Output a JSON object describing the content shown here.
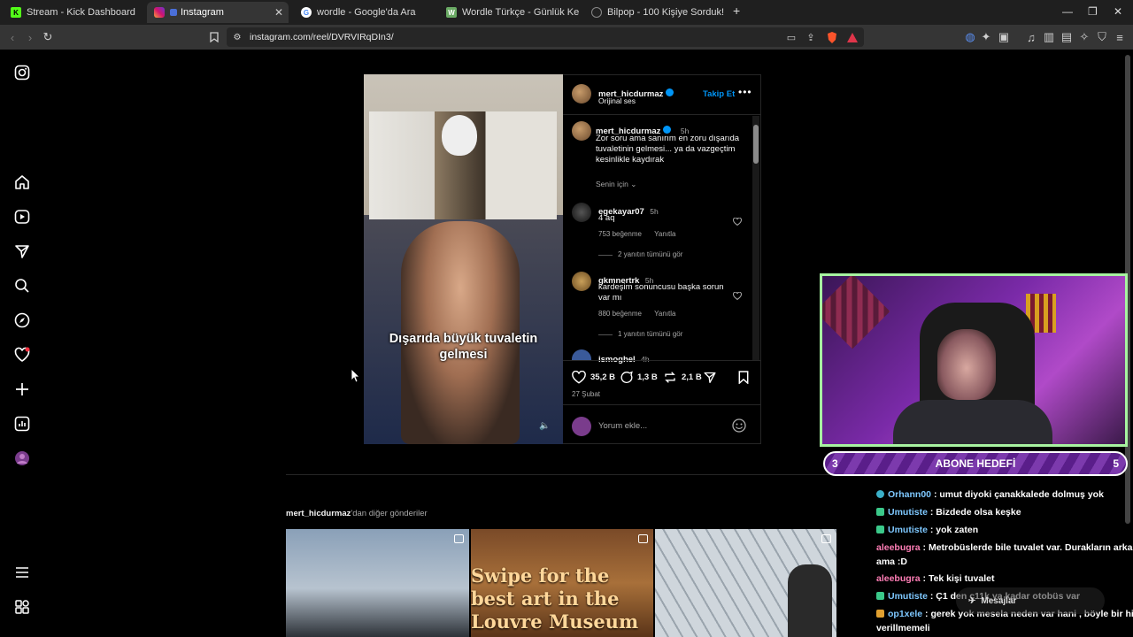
{
  "browser": {
    "tabs": [
      {
        "title": "Stream - Kick Dashboard",
        "favicon": "K",
        "color": "#53fc18"
      },
      {
        "title": "Instagram",
        "active": true
      },
      {
        "title": "wordle - Google'da Ara"
      },
      {
        "title": "Wordle Türkçe - Günlük Kelime Oyunu",
        "favicon": "W",
        "color": "#6aaa64"
      },
      {
        "title": "Bilpop - 100 Kişiye Sorduk!"
      }
    ],
    "url": "instagram.com/reel/DVRVIRqDIn3/"
  },
  "reel": {
    "caption_overlay": "Dışarıda büyük tuvaletin gelmesi",
    "author": "mert_hicdurmaz",
    "audio": "Orijinal ses",
    "follow_label": "Takip Et",
    "post": {
      "username": "mert_hicdurmaz",
      "time": "5h",
      "text": "Zor soru ama sanırım en zoru dışarıda tuvaletinin gelmesi... ya da vazgeçtim kesinlikle kaydırak"
    },
    "sort_label": "Senin için",
    "comments": [
      {
        "username": "egekayar07",
        "time": "5h",
        "text": "4 aq",
        "likes": "753 beğenme",
        "reply": "Yanıtla",
        "view_replies": "2 yanıtın tümünü gör"
      },
      {
        "username": "gkmnertrk",
        "time": "5h",
        "text": "kardeşim sonuncusu başka sorun var mı",
        "likes": "880 beğenme",
        "reply": "Yanıtla",
        "view_replies": "1 yanıtın tümünü gör"
      },
      {
        "username": "ismoghel",
        "time": "4h"
      }
    ],
    "likes": "35,2 B",
    "comments_count": "1,3 B",
    "reposts": "2,1 B",
    "date": "27 Şubat",
    "comment_placeholder": "Yorum ekle..."
  },
  "more_posts": {
    "user": "mert_hicdurmaz",
    "suffix": "'dan diğer gönderiler",
    "thumb2_text": "Swipe for the best art in the Louvre Museum"
  },
  "goal": {
    "left": "3",
    "label": "ABONE HEDEFİ",
    "right": "5"
  },
  "chat": [
    {
      "user": "Orhann00",
      "user_color": "#7ec8ff",
      "badge_color": "#3bb0c9",
      "text": ": umut diyoki çanakkalede dolmuş yok"
    },
    {
      "user": "Umutiste",
      "user_color": "#7ec8ff",
      "badge_color": "#3bc98a",
      "text": ": Bizdede olsa keşke"
    },
    {
      "user": "Umutiste",
      "user_color": "#7ec8ff",
      "badge_color": "#3bc98a",
      "text": ": yok zaten"
    },
    {
      "user": "aleebugra",
      "user_color": "#ff7eb6",
      "badge_color": "",
      "text": ": Metrobüslerde bile tuvalet var. Durakların arkası"
    },
    {
      "user": "",
      "user_color": "",
      "badge_color": "",
      "text": "ama :D"
    },
    {
      "user": "aleebugra",
      "user_color": "#ff7eb6",
      "badge_color": "",
      "text": ": Tek kişi tuvalet"
    },
    {
      "user": "Umutiste",
      "user_color": "#7ec8ff",
      "badge_color": "#3bc98a",
      "text": ": Ç1 den ç11k ya kadar otobüs var"
    },
    {
      "user": "op1xele",
      "user_color": "#7ec8ff",
      "badge_color": "#e0a030",
      "text": ": gerek yok mesela neden var hani , böyle bir hizmet"
    },
    {
      "user": "",
      "user_color": "",
      "badge_color": "",
      "text": "verillmemeli"
    }
  ],
  "messages_label": "Mesajlar"
}
